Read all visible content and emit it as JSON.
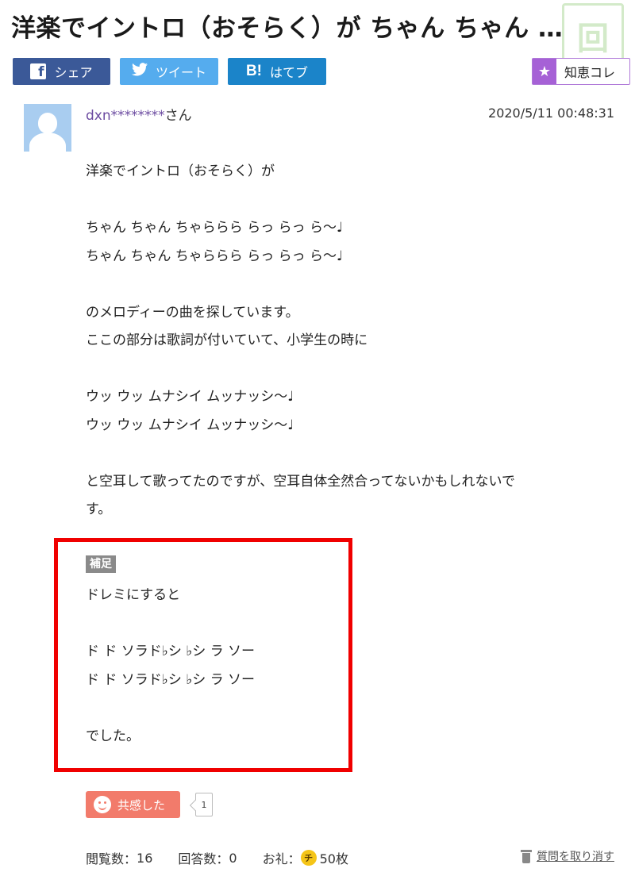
{
  "question": {
    "title": "洋楽でイントロ（おそらく）が ちゃん ちゃん …",
    "author": "dxn********",
    "author_suffix": "さん",
    "datetime": "2020/5/11  00:48:31",
    "body": [
      "洋楽でイントロ（おそらく）が",
      "",
      "ちゃん ちゃん ちゃららら らっ らっ ら～♩",
      "ちゃん ちゃん ちゃららら らっ らっ ら～♩",
      "",
      "のメロディーの曲を探しています。",
      "ここの部分は歌詞が付いていて、小学生の時に",
      "",
      "ウッ ウッ ムナシイ ムッナッシ～♩",
      "ウッ ウッ ムナシイ ムッナッシ～♩",
      "",
      "と空耳して歌ってたのですが、空耳自体全然合ってないかもしれないで",
      "す。"
    ]
  },
  "supplement": {
    "label": "補足",
    "body": [
      "ドレミにすると",
      "",
      "ド ド ソラド♭シ ♭シ ラ ソー",
      "ド ド ソラド♭シ ♭シ ラ ソー",
      "",
      "でした。"
    ]
  },
  "share": {
    "facebook_label": "シェア",
    "twitter_label": "ツイート",
    "hatena_label": "はてブ",
    "hatena_icon_text": "B!",
    "chiekore_label": "知恵コレ"
  },
  "reactions": {
    "empathy_label": "共感した",
    "empathy_count": "1"
  },
  "stats": {
    "views_label": "閲覧数：",
    "views": "16",
    "answers_label": "回答数：",
    "answers": "0",
    "reward_label": "お礼：",
    "coin_text": "チ",
    "reward": "50枚",
    "cancel_label": "質問を取り消す"
  },
  "colors": {
    "facebook": "#3b5998",
    "twitter": "#55acee",
    "hatena": "#1b84c9",
    "chiekore": "#a661d6",
    "empathy": "#f27b6b",
    "highlight_border": "#f00000",
    "username": "#6b4aa0"
  },
  "icons": [
    "facebook-icon",
    "twitter-bird-icon",
    "hatena-bookmark-icon",
    "star-icon",
    "default-avatar-icon",
    "smile-icon",
    "coin-icon",
    "trash-icon"
  ]
}
